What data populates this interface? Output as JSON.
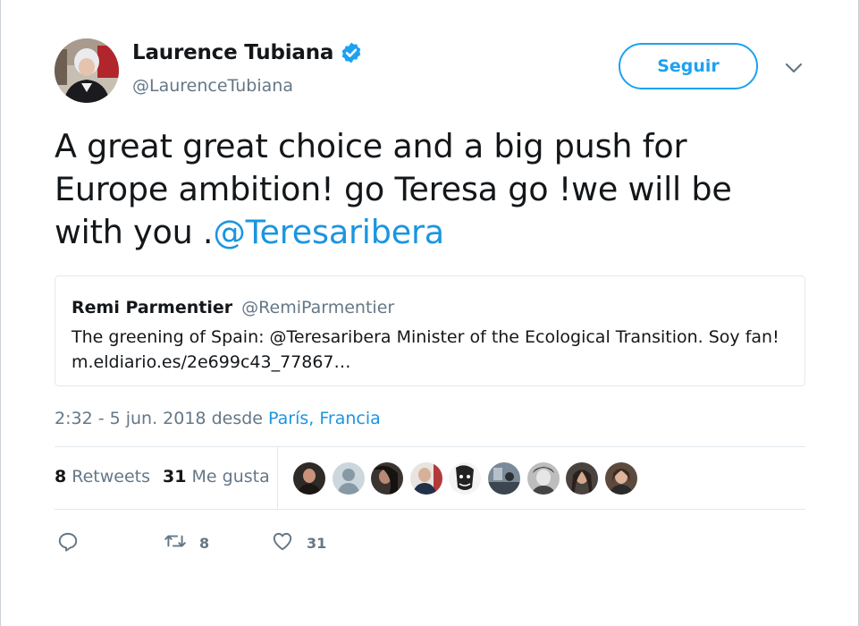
{
  "author": {
    "display_name": "Laurence Tubiana",
    "handle": "@LaurenceTubiana",
    "verified": true
  },
  "follow_button": {
    "label": "Seguir"
  },
  "tweet": {
    "text": "A great great choice and a big push for Europe ambition! go Teresa go !we will be with you .",
    "mention": "@Teresaribera"
  },
  "quoted_tweet": {
    "display_name": "Remi Parmentier",
    "handle": "@RemiParmentier",
    "text": "The greening of Spain: @Teresaribera Minister of the Ecological Transition. Soy fan!",
    "link": "m.eldiario.es/2e699c43_77867…"
  },
  "meta": {
    "timestamp": "2:32 - 5 jun. 2018 desde ",
    "place": "París, Francia"
  },
  "stats": {
    "retweets_count": "8",
    "retweets_label": " Retweets",
    "likes_count": "31",
    "likes_label": " Me gusta"
  },
  "actions": {
    "reply_count": "",
    "retweet_count": "8",
    "like_count": "31"
  },
  "colors": {
    "accent": "#1da1f2",
    "link": "#1b95e0",
    "text": "#14171a",
    "secondary": "#657786",
    "border": "#e1e8ed"
  },
  "icons": [
    "verified-badge-icon",
    "caret-down-icon",
    "reply-icon",
    "retweet-icon",
    "heart-icon"
  ]
}
